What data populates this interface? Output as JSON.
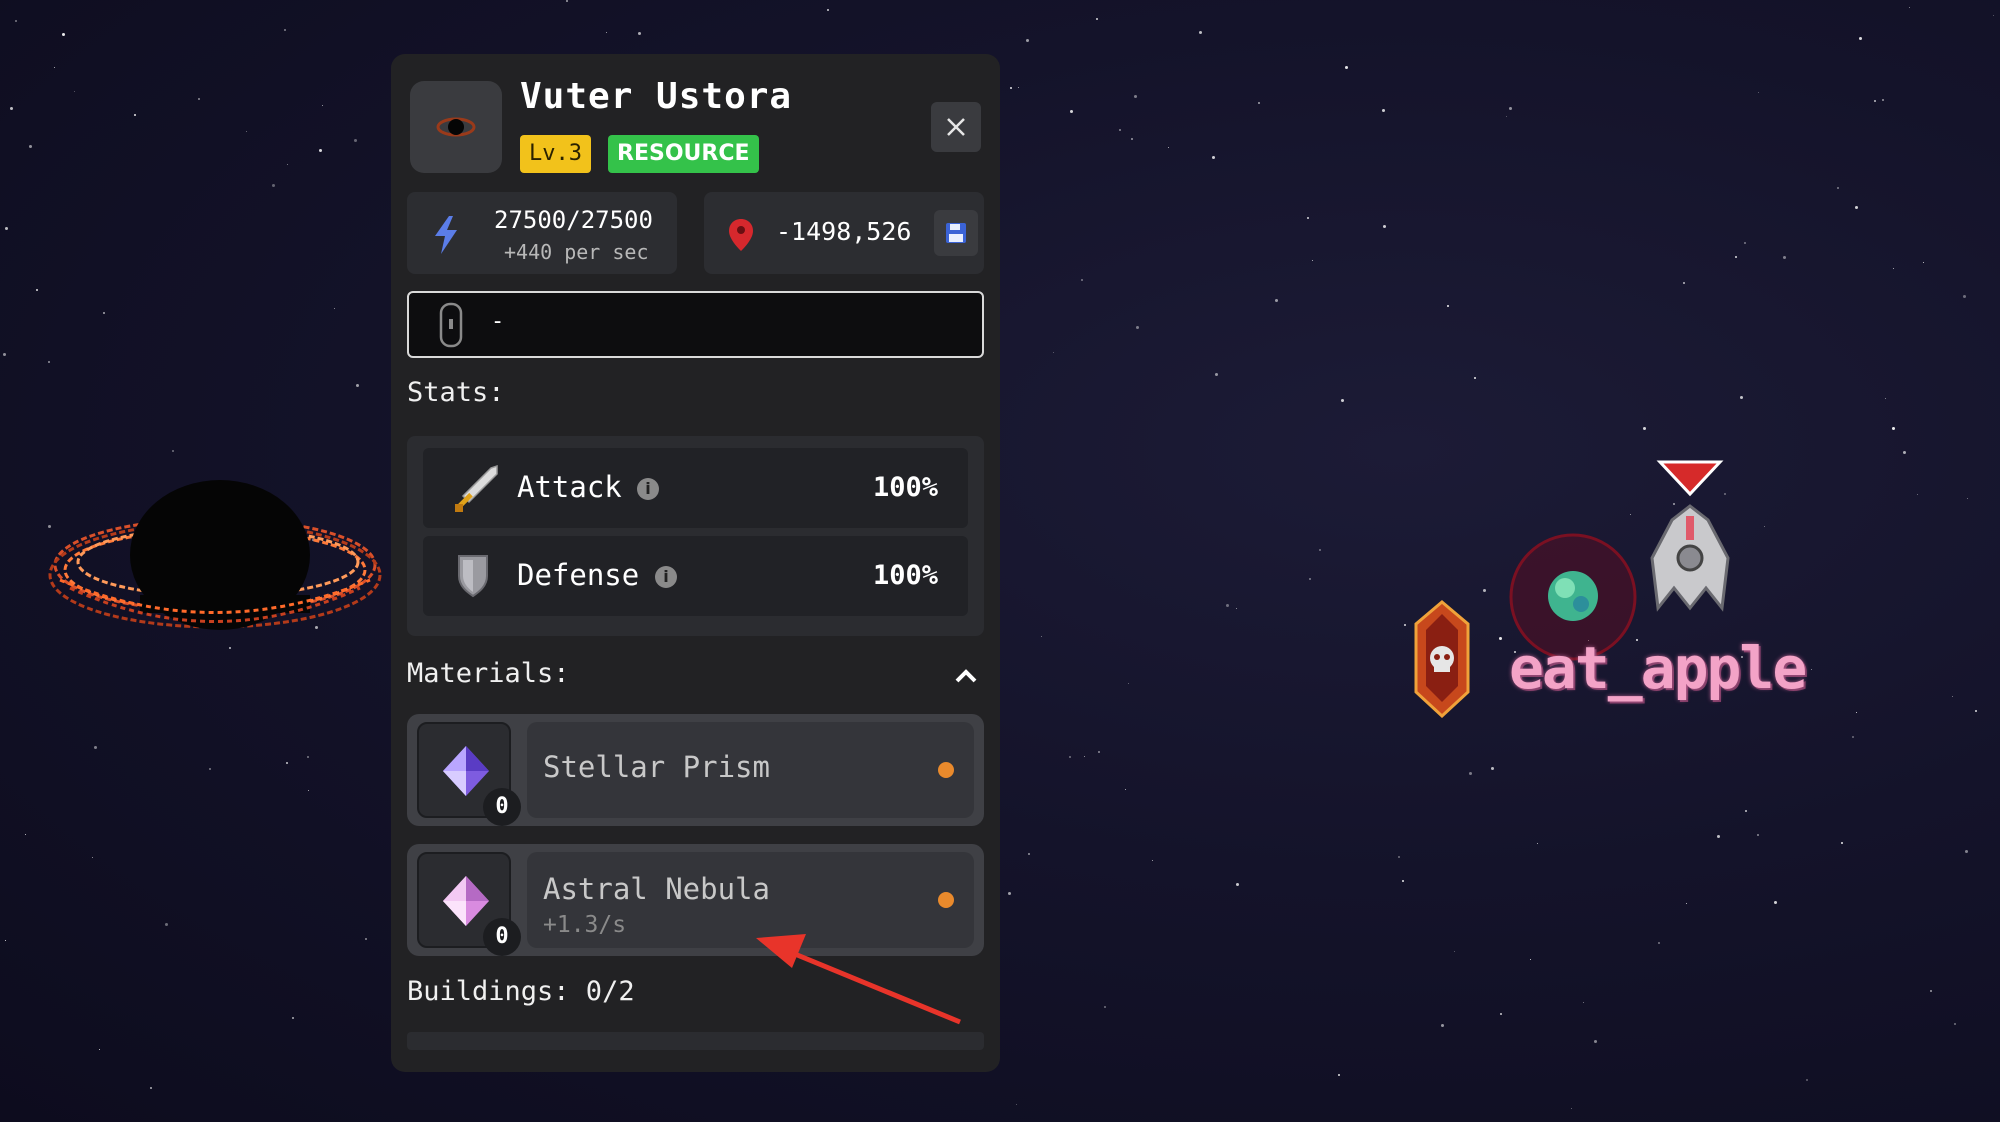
{
  "planet": {
    "name": "Vuter Ustora",
    "level": "Lv.3",
    "type": "RESOURCE",
    "energy": "27500/27500",
    "energy_rate": "+440 per sec",
    "coordinates": "-1498,526",
    "owner_input": "-"
  },
  "stats": {
    "label": "Stats:",
    "items": [
      {
        "label": "Attack",
        "value": "100%",
        "icon": "sword-icon"
      },
      {
        "label": "Defense",
        "value": "100%",
        "icon": "shield-icon"
      }
    ]
  },
  "materials": {
    "label": "Materials:",
    "items": [
      {
        "name": "Stellar Prism",
        "count": "0",
        "rate": "",
        "gem_color": "#9a7cf0",
        "status_color": "#e98a2c"
      },
      {
        "name": "Astral Nebula",
        "count": "0",
        "rate": "+1.3/s",
        "gem_color": "#e3a6ea",
        "status_color": "#e98a2c"
      }
    ]
  },
  "buildings": {
    "label": "Buildings: 0/2"
  },
  "map": {
    "player_name": "eat_apple"
  },
  "colors": {
    "level_badge": "#f2c21b",
    "resource_badge": "#34c24a",
    "arrow": "#e8342a"
  }
}
